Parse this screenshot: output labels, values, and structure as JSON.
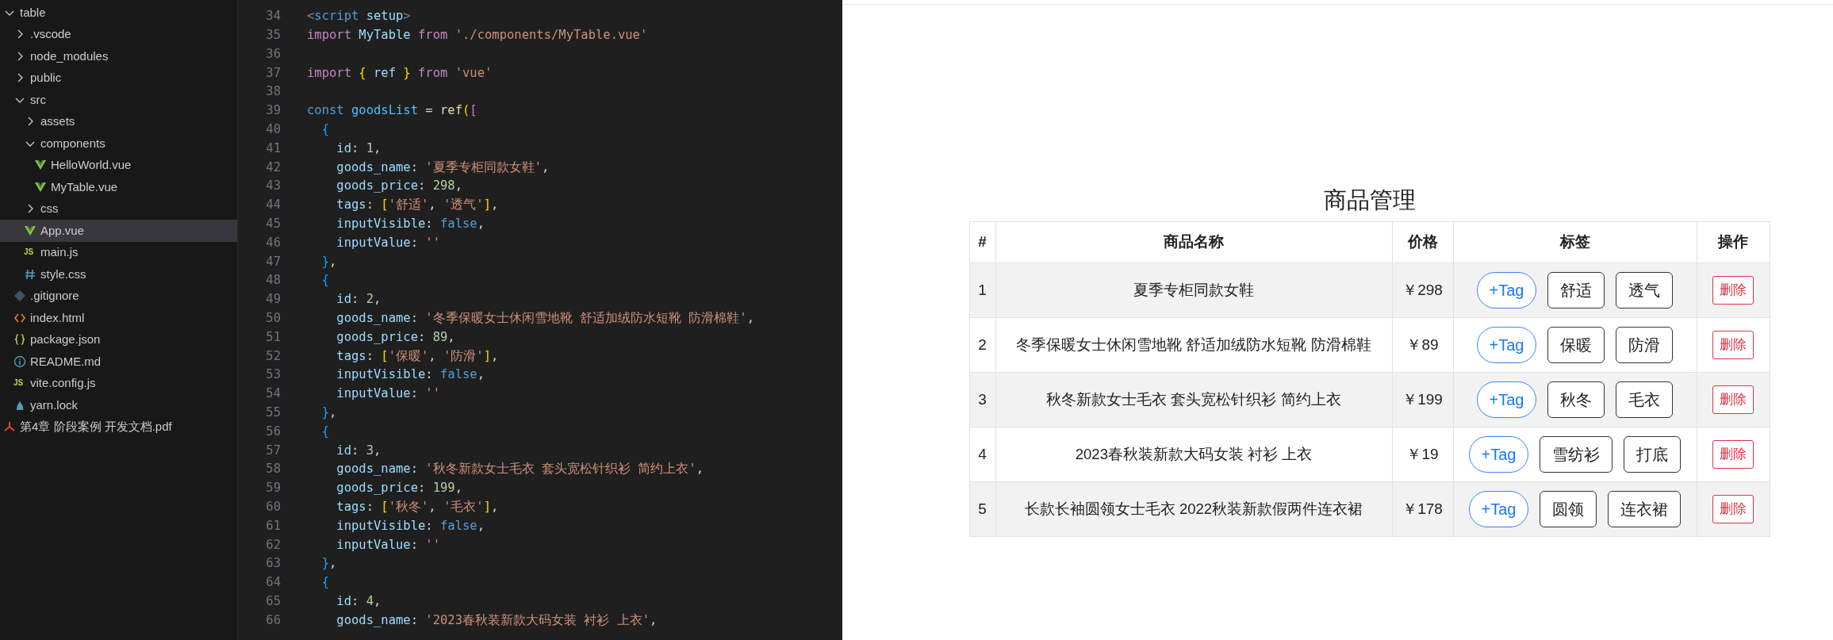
{
  "explorer": {
    "items": [
      {
        "label": "table",
        "kind": "folder",
        "expanded": true,
        "selected": false,
        "children": [
          {
            "label": ".vscode",
            "kind": "folder",
            "expanded": false,
            "selected": false
          },
          {
            "label": "node_modules",
            "kind": "folder",
            "expanded": false,
            "selected": false
          },
          {
            "label": "public",
            "kind": "folder",
            "expanded": false,
            "selected": false
          },
          {
            "label": "src",
            "kind": "folder",
            "expanded": true,
            "selected": false,
            "children": [
              {
                "label": "assets",
                "kind": "folder",
                "expanded": false,
                "selected": false
              },
              {
                "label": "components",
                "kind": "folder",
                "expanded": true,
                "selected": false,
                "children": [
                  {
                    "label": "HelloWorld.vue",
                    "kind": "vue",
                    "selected": false
                  },
                  {
                    "label": "MyTable.vue",
                    "kind": "vue",
                    "selected": false
                  }
                ]
              },
              {
                "label": "css",
                "kind": "folder",
                "expanded": false,
                "selected": false
              },
              {
                "label": "App.vue",
                "kind": "vue",
                "selected": true
              },
              {
                "label": "main.js",
                "kind": "js",
                "badge": "JS",
                "selected": false
              },
              {
                "label": "style.css",
                "kind": "css",
                "selected": false
              }
            ]
          },
          {
            "label": ".gitignore",
            "kind": "git",
            "selected": false
          },
          {
            "label": "index.html",
            "kind": "html",
            "selected": false
          },
          {
            "label": "package.json",
            "kind": "json",
            "selected": false
          },
          {
            "label": "README.md",
            "kind": "info",
            "selected": false
          },
          {
            "label": "vite.config.js",
            "kind": "js",
            "badge": "JS",
            "selected": false
          },
          {
            "label": "yarn.lock",
            "kind": "yarn",
            "selected": false
          }
        ]
      },
      {
        "label": "第4章 阶段案例 开发文档.pdf",
        "kind": "pdf",
        "selected": false
      }
    ]
  },
  "editor": {
    "lines": [
      {
        "number": "34",
        "tokens": [
          {
            "text": "<",
            "kind": "angle"
          },
          {
            "text": "script",
            "kind": "tag"
          },
          {
            "text": " setup",
            "kind": "var"
          },
          {
            "text": ">",
            "kind": "angle"
          }
        ]
      },
      {
        "number": "35",
        "tokens": [
          {
            "text": "import",
            "kind": "keyword"
          },
          {
            "text": " MyTable ",
            "kind": "var"
          },
          {
            "text": "from",
            "kind": "keyword"
          },
          {
            "text": " './components/MyTable.vue'",
            "kind": "string"
          }
        ]
      },
      {
        "number": "36"
      },
      {
        "number": "37",
        "tokens": [
          {
            "text": "import ",
            "kind": "keyword"
          },
          {
            "text": "{",
            "kind": "bracket1"
          },
          {
            "text": " ref ",
            "kind": "var"
          },
          {
            "text": "}",
            "kind": "bracket1"
          },
          {
            "text": " from",
            "kind": "keyword"
          },
          {
            "text": " 'vue'",
            "kind": "string"
          }
        ]
      },
      {
        "number": "38"
      },
      {
        "number": "39",
        "tokens": [
          {
            "text": "const",
            "kind": "storage"
          },
          {
            "text": " goodsList",
            "kind": "constant"
          },
          {
            "text": " = ",
            "kind": "plain"
          },
          {
            "text": "ref",
            "kind": "function"
          },
          {
            "text": "(",
            "kind": "bracket1"
          },
          {
            "text": "[",
            "kind": "bracket2"
          }
        ]
      },
      {
        "number": "40",
        "tokens": [
          {
            "text": "  {",
            "kind": "bracket3"
          }
        ]
      },
      {
        "number": "41",
        "tokens": [
          {
            "text": "    id",
            "kind": "var"
          },
          {
            "text": ": ",
            "kind": "plain"
          },
          {
            "text": "1",
            "kind": "number"
          },
          {
            "text": ",",
            "kind": "plain"
          }
        ]
      },
      {
        "number": "42",
        "tokens": [
          {
            "text": "    goods_name",
            "kind": "var"
          },
          {
            "text": ": ",
            "kind": "plain"
          },
          {
            "text": "'夏季专柜同款女鞋'",
            "kind": "string"
          },
          {
            "text": ",",
            "kind": "plain"
          }
        ]
      },
      {
        "number": "43",
        "tokens": [
          {
            "text": "    goods_price",
            "kind": "var"
          },
          {
            "text": ": ",
            "kind": "plain"
          },
          {
            "text": "298",
            "kind": "number"
          },
          {
            "text": ",",
            "kind": "plain"
          }
        ]
      },
      {
        "number": "44",
        "tokens": [
          {
            "text": "    tags",
            "kind": "var"
          },
          {
            "text": ": ",
            "kind": "plain"
          },
          {
            "text": "[",
            "kind": "bracket1"
          },
          {
            "text": "'舒适'",
            "kind": "string"
          },
          {
            "text": ", ",
            "kind": "plain"
          },
          {
            "text": "'透气'",
            "kind": "string"
          },
          {
            "text": "]",
            "kind": "bracket1"
          },
          {
            "text": ",",
            "kind": "plain"
          }
        ]
      },
      {
        "number": "45",
        "tokens": [
          {
            "text": "    inputVisible",
            "kind": "var"
          },
          {
            "text": ": ",
            "kind": "plain"
          },
          {
            "text": "false",
            "kind": "storage"
          },
          {
            "text": ",",
            "kind": "plain"
          }
        ]
      },
      {
        "number": "46",
        "tokens": [
          {
            "text": "    inputValue",
            "kind": "var"
          },
          {
            "text": ": ",
            "kind": "plain"
          },
          {
            "text": "''",
            "kind": "string"
          }
        ]
      },
      {
        "number": "47",
        "tokens": [
          {
            "text": "  }",
            "kind": "bracket3"
          },
          {
            "text": ",",
            "kind": "plain"
          }
        ]
      },
      {
        "number": "48",
        "tokens": [
          {
            "text": "  {",
            "kind": "bracket3"
          }
        ]
      },
      {
        "number": "49",
        "tokens": [
          {
            "text": "    id",
            "kind": "var"
          },
          {
            "text": ": ",
            "kind": "plain"
          },
          {
            "text": "2",
            "kind": "number"
          },
          {
            "text": ",",
            "kind": "plain"
          }
        ]
      },
      {
        "number": "50",
        "tokens": [
          {
            "text": "    goods_name",
            "kind": "var"
          },
          {
            "text": ": ",
            "kind": "plain"
          },
          {
            "text": "'冬季保暖女士休闲雪地靴 舒适加绒防水短靴 防滑棉鞋'",
            "kind": "string"
          },
          {
            "text": ",",
            "kind": "plain"
          }
        ]
      },
      {
        "number": "51",
        "tokens": [
          {
            "text": "    goods_price",
            "kind": "var"
          },
          {
            "text": ": ",
            "kind": "plain"
          },
          {
            "text": "89",
            "kind": "number"
          },
          {
            "text": ",",
            "kind": "plain"
          }
        ]
      },
      {
        "number": "52",
        "tokens": [
          {
            "text": "    tags",
            "kind": "var"
          },
          {
            "text": ": ",
            "kind": "plain"
          },
          {
            "text": "[",
            "kind": "bracket1"
          },
          {
            "text": "'保暖'",
            "kind": "string"
          },
          {
            "text": ", ",
            "kind": "plain"
          },
          {
            "text": "'防滑'",
            "kind": "string"
          },
          {
            "text": "]",
            "kind": "bracket1"
          },
          {
            "text": ",",
            "kind": "plain"
          }
        ]
      },
      {
        "number": "53",
        "tokens": [
          {
            "text": "    inputVisible",
            "kind": "var"
          },
          {
            "text": ": ",
            "kind": "plain"
          },
          {
            "text": "false",
            "kind": "storage"
          },
          {
            "text": ",",
            "kind": "plain"
          }
        ]
      },
      {
        "number": "54",
        "tokens": [
          {
            "text": "    inputValue",
            "kind": "var"
          },
          {
            "text": ": ",
            "kind": "plain"
          },
          {
            "text": "''",
            "kind": "string"
          }
        ]
      },
      {
        "number": "55",
        "tokens": [
          {
            "text": "  }",
            "kind": "bracket3"
          },
          {
            "text": ",",
            "kind": "plain"
          }
        ]
      },
      {
        "number": "56",
        "tokens": [
          {
            "text": "  {",
            "kind": "bracket3"
          }
        ]
      },
      {
        "number": "57",
        "tokens": [
          {
            "text": "    id",
            "kind": "var"
          },
          {
            "text": ": ",
            "kind": "plain"
          },
          {
            "text": "3",
            "kind": "number"
          },
          {
            "text": ",",
            "kind": "plain"
          }
        ]
      },
      {
        "number": "58",
        "tokens": [
          {
            "text": "    goods_name",
            "kind": "var"
          },
          {
            "text": ": ",
            "kind": "plain"
          },
          {
            "text": "'秋冬新款女士毛衣 套头宽松针织衫 简约上衣'",
            "kind": "string"
          },
          {
            "text": ",",
            "kind": "plain"
          }
        ]
      },
      {
        "number": "59",
        "tokens": [
          {
            "text": "    goods_price",
            "kind": "var"
          },
          {
            "text": ": ",
            "kind": "plain"
          },
          {
            "text": "199",
            "kind": "number"
          },
          {
            "text": ",",
            "kind": "plain"
          }
        ]
      },
      {
        "number": "60",
        "tokens": [
          {
            "text": "    tags",
            "kind": "var"
          },
          {
            "text": ": ",
            "kind": "plain"
          },
          {
            "text": "[",
            "kind": "bracket1"
          },
          {
            "text": "'秋冬'",
            "kind": "string"
          },
          {
            "text": ", ",
            "kind": "plain"
          },
          {
            "text": "'毛衣'",
            "kind": "string"
          },
          {
            "text": "]",
            "kind": "bracket1"
          },
          {
            "text": ",",
            "kind": "plain"
          }
        ]
      },
      {
        "number": "61",
        "tokens": [
          {
            "text": "    inputVisible",
            "kind": "var"
          },
          {
            "text": ": ",
            "kind": "plain"
          },
          {
            "text": "false",
            "kind": "storage"
          },
          {
            "text": ",",
            "kind": "plain"
          }
        ]
      },
      {
        "number": "62",
        "tokens": [
          {
            "text": "    inputValue",
            "kind": "var"
          },
          {
            "text": ": ",
            "kind": "plain"
          },
          {
            "text": "''",
            "kind": "string"
          }
        ]
      },
      {
        "number": "63",
        "tokens": [
          {
            "text": "  }",
            "kind": "bracket3"
          },
          {
            "text": ",",
            "kind": "plain"
          }
        ]
      },
      {
        "number": "64",
        "tokens": [
          {
            "text": "  {",
            "kind": "bracket3"
          }
        ]
      },
      {
        "number": "65",
        "tokens": [
          {
            "text": "    id",
            "kind": "var"
          },
          {
            "text": ": ",
            "kind": "plain"
          },
          {
            "text": "4",
            "kind": "number"
          },
          {
            "text": ",",
            "kind": "plain"
          }
        ]
      },
      {
        "number": "66",
        "tokens": [
          {
            "text": "    goods_name",
            "kind": "var"
          },
          {
            "text": ": ",
            "kind": "plain"
          },
          {
            "text": "'2023春秋装新款大码女装 衬衫 上衣'",
            "kind": "string"
          },
          {
            "text": ",",
            "kind": "plain"
          }
        ]
      }
    ]
  },
  "page": {
    "title": "商品管理",
    "table": {
      "columns": [
        "#",
        "商品名称",
        "价格",
        "标签",
        "操作"
      ],
      "rows": [
        {
          "index": "1",
          "name": "夏季专柜同款女鞋",
          "price": "￥298",
          "add_tag": "+Tag",
          "tags": [
            "舒适",
            "透气"
          ],
          "action": "删除"
        },
        {
          "index": "2",
          "name": "冬季保暖女士休闲雪地靴 舒适加绒防水短靴 防滑棉鞋",
          "price": "￥89",
          "add_tag": "+Tag",
          "tags": [
            "保暖",
            "防滑"
          ],
          "action": "删除"
        },
        {
          "index": "3",
          "name": "秋冬新款女士毛衣 套头宽松针织衫 简约上衣",
          "price": "￥199",
          "add_tag": "+Tag",
          "tags": [
            "秋冬",
            "毛衣"
          ],
          "action": "删除"
        },
        {
          "index": "4",
          "name": "2023春秋装新款大码女装 衬衫 上衣",
          "price": "￥19",
          "add_tag": "+Tag",
          "tags": [
            "雪纺衫",
            "打底"
          ],
          "action": "删除"
        },
        {
          "index": "5",
          "name": "长款长袖圆领女士毛衣 2022秋装新款假两件连衣裙",
          "price": "￥178",
          "add_tag": "+Tag",
          "tags": [
            "圆领",
            "连衣裙"
          ],
          "action": "删除"
        }
      ]
    }
  }
}
